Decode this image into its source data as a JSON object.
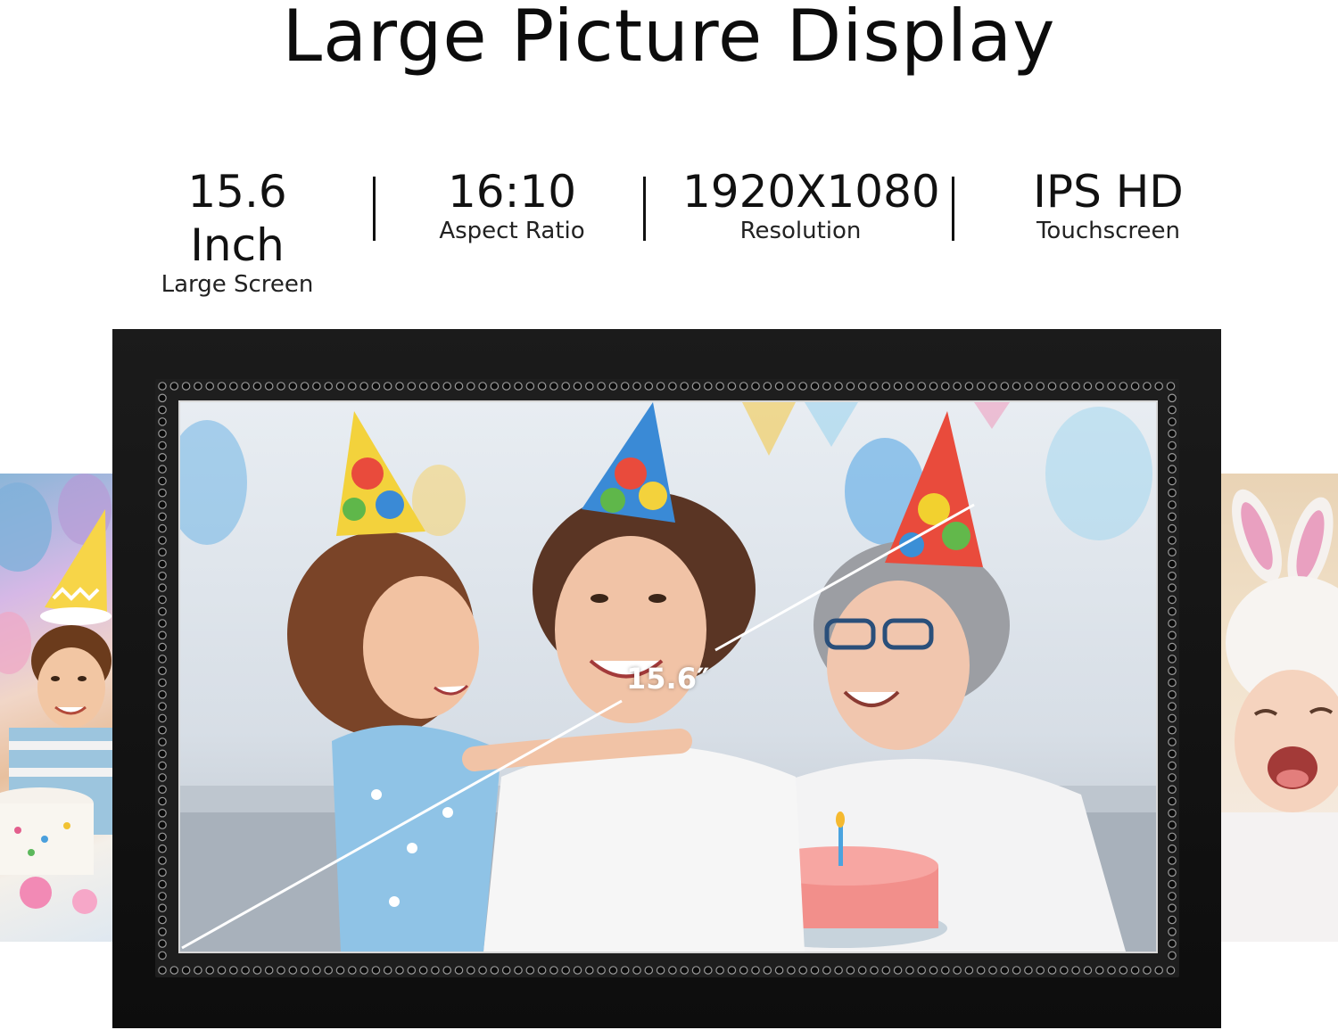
{
  "title": "Large Picture Display",
  "specs": [
    {
      "value": "15.6 Inch",
      "label": "Large Screen"
    },
    {
      "value": "16:10",
      "label": "Aspect Ratio"
    },
    {
      "value": "1920X1080",
      "label": "Resolution"
    },
    {
      "value": "IPS HD",
      "label": "Touchscreen"
    }
  ],
  "screen": {
    "diagonal_label": "15.6″"
  },
  "colors": {
    "frame": "#111111",
    "background": "#ffffff",
    "text": "#111111"
  }
}
